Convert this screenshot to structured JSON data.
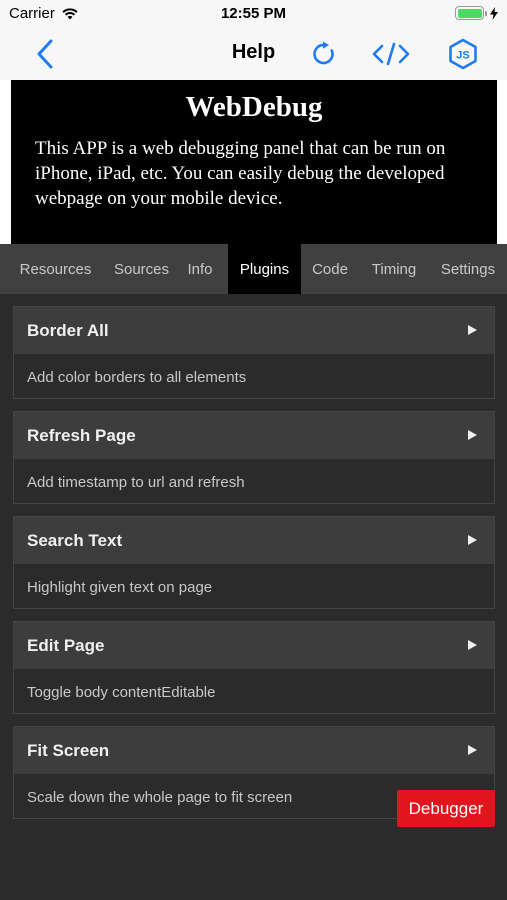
{
  "status_bar": {
    "carrier": "Carrier",
    "time": "12:55 PM",
    "battery_level": 1.0,
    "icons": [
      "wifi-icon",
      "battery-icon",
      "charging-bolt-icon"
    ]
  },
  "nav": {
    "title": "Help",
    "back_icon": "chevron-left-icon",
    "action_icons": [
      "refresh-icon",
      "code-icon",
      "js-icon"
    ],
    "js_badge": "JS",
    "accent_color": "#1e7bf2"
  },
  "webpage": {
    "title": "WebDebug",
    "description": "This APP is a web debugging panel that can be run on iPhone, iPad, etc. You can easily debug the developed webpage on your mobile device."
  },
  "tabs": [
    {
      "label": "Resources",
      "active": false
    },
    {
      "label": "Sources",
      "active": false
    },
    {
      "label": "Info",
      "active": false
    },
    {
      "label": "Plugins",
      "active": true
    },
    {
      "label": "Code",
      "active": false
    },
    {
      "label": "Timing",
      "active": false
    },
    {
      "label": "Settings",
      "active": false
    }
  ],
  "plugins": [
    {
      "title": "Border All",
      "description": "Add color borders to all elements"
    },
    {
      "title": "Refresh Page",
      "description": "Add timestamp to url and refresh"
    },
    {
      "title": "Search Text",
      "description": "Highlight given text on page"
    },
    {
      "title": "Edit Page",
      "description": "Toggle body contentEditable"
    },
    {
      "title": "Fit Screen",
      "description": "Scale down the whole page to fit screen"
    }
  ],
  "debugger_button": {
    "label": "Debugger",
    "color": "#e0151e"
  }
}
